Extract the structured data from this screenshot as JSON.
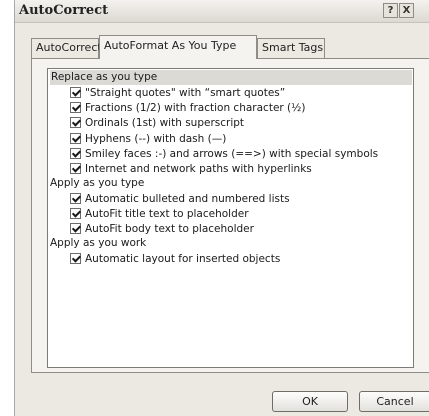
{
  "window": {
    "title": "AutoCorrect",
    "help_glyph": "?",
    "close_glyph": "X"
  },
  "tabs": [
    {
      "label": "AutoCorrect",
      "active": false
    },
    {
      "label": "AutoFormat As You Type",
      "active": true
    },
    {
      "label": "Smart Tags",
      "active": false
    }
  ],
  "groups": [
    {
      "header": "Replace as you type",
      "selected": true,
      "items": [
        {
          "label": "\"Straight quotes\" with “smart quotes”",
          "checked": true
        },
        {
          "label": "Fractions (1/2) with fraction character (½)",
          "checked": true
        },
        {
          "label": "Ordinals (1st) with superscript",
          "checked": true
        },
        {
          "label": "Hyphens (--) with dash (—)",
          "checked": true
        },
        {
          "label": "Smiley faces :-) and arrows (==>) with special symbols",
          "checked": true
        },
        {
          "label": "Internet and network paths with hyperlinks",
          "checked": true
        }
      ]
    },
    {
      "header": "Apply as you type",
      "selected": false,
      "items": [
        {
          "label": "Automatic bulleted and numbered lists",
          "checked": true
        },
        {
          "label": "AutoFit title text to placeholder",
          "checked": true
        },
        {
          "label": "AutoFit body text to placeholder",
          "checked": true
        }
      ]
    },
    {
      "header": "Apply as you work",
      "selected": false,
      "items": [
        {
          "label": "Automatic layout for inserted objects",
          "checked": true
        }
      ]
    }
  ],
  "buttons": {
    "ok": "OK",
    "cancel": "Cancel"
  }
}
